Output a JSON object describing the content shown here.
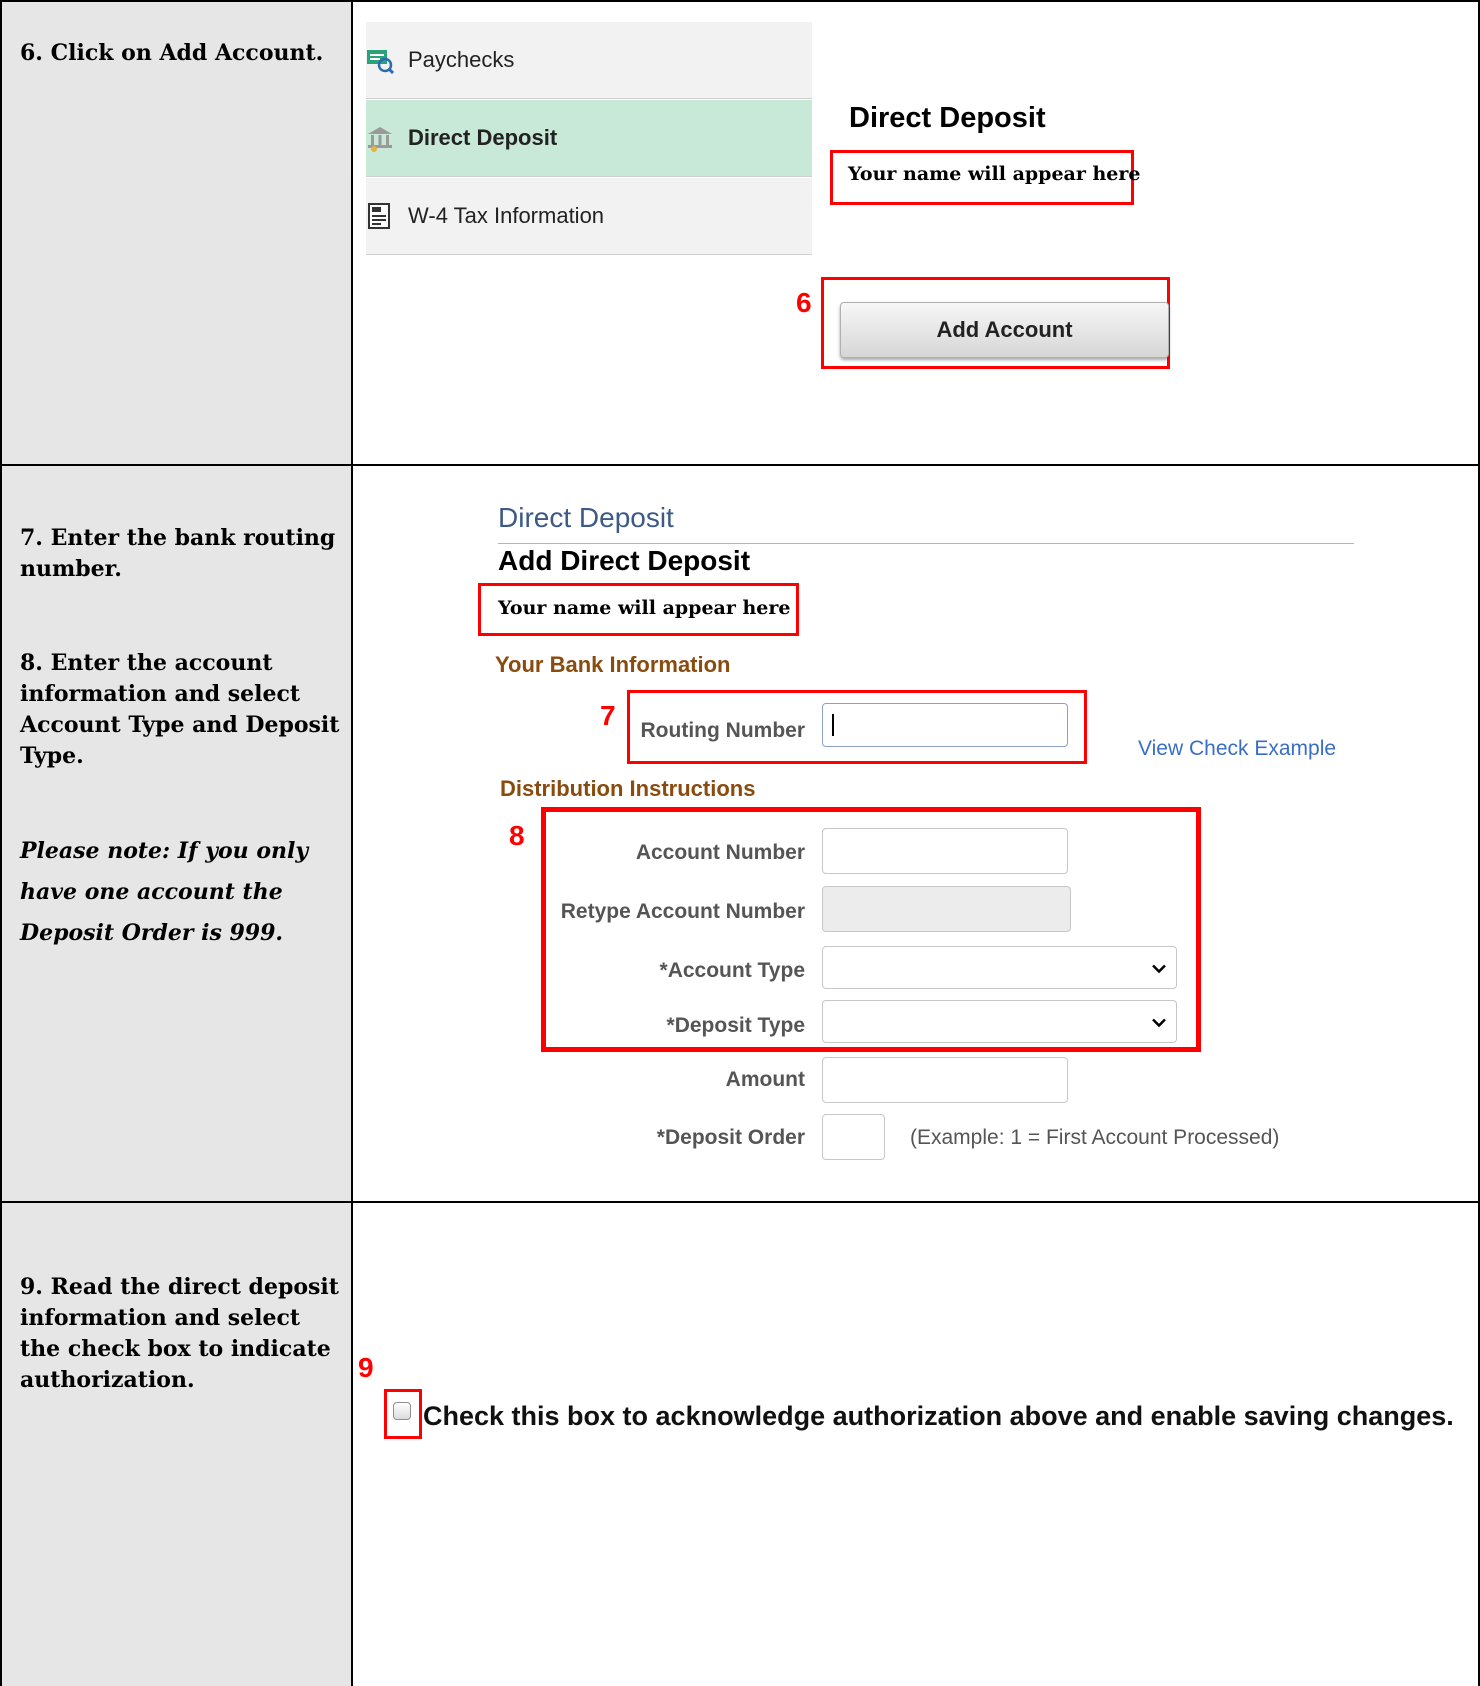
{
  "steps": [
    {
      "text": "6.  Click on Add Account."
    },
    {
      "text": "7.  Enter the bank routing\nnumber.",
      "text2": "8.  Enter the account\ninformation and select\nAccount Type and Deposit\nType.",
      "note": "Please note: If you only\nhave one account the\nDeposit Order is 999."
    },
    {
      "text": "9.  Read the direct deposit\ninformation and select\nthe check box to indicate\nauthorization."
    }
  ],
  "sidebar": {
    "items": [
      {
        "label": "Paychecks",
        "icon": "paychecks-icon"
      },
      {
        "label": "Direct Deposit",
        "icon": "bank-icon"
      },
      {
        "label": "W-4 Tax Information",
        "icon": "tax-form-icon"
      }
    ]
  },
  "section1": {
    "heading": "Direct Deposit",
    "name_placeholder": "Your name will appear here",
    "add_button": "Add Account",
    "callout": "6"
  },
  "section2": {
    "page_title": "Direct Deposit",
    "subtitle": "Add Direct Deposit",
    "name_placeholder": "Your name will appear here",
    "bank_info_heading": "Your Bank Information",
    "routing_label": "Routing Number",
    "view_check": "View Check Example",
    "distribution_heading": "Distribution Instructions",
    "account_number_label": "Account Number",
    "retype_label": "Retype Account Number",
    "account_type_label": "*Account Type",
    "deposit_type_label": "*Deposit Type",
    "amount_label": "Amount",
    "deposit_order_label": "*Deposit Order",
    "deposit_order_hint": "(Example: 1 = First Account Processed)",
    "callout7": "7",
    "callout8": "8"
  },
  "section3": {
    "checkbox_label": "Check this box to acknowledge authorization above and enable saving changes.",
    "callout": "9"
  },
  "colors": {
    "accent_red": "#ff0000",
    "active_nav": "#c8e8d8",
    "section_heading_brown": "#8a4b0f",
    "link_blue": "#3a6ec6",
    "page_title_blue": "#3d5a86"
  }
}
